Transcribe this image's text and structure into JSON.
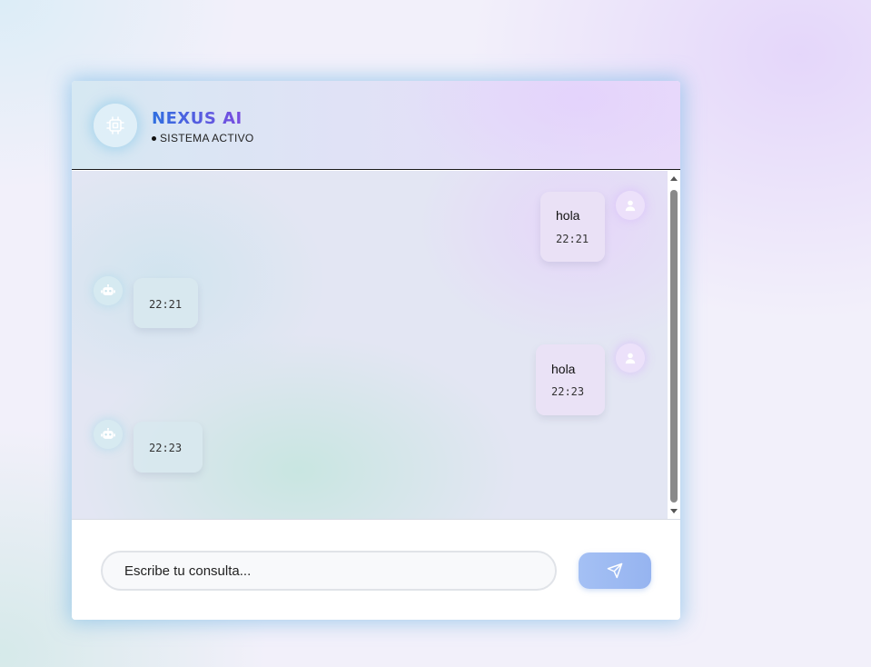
{
  "header": {
    "title": "NEXUS AI",
    "status": "SISTEMA ACTIVO",
    "avatar_icon": "cpu-chip-icon"
  },
  "messages": [
    {
      "sender": "user",
      "text": "hola",
      "time": "22:21",
      "avatar_icon": "user-icon"
    },
    {
      "sender": "bot",
      "text": "",
      "time": "22:21",
      "avatar_icon": "robot-icon"
    },
    {
      "sender": "user",
      "text": "hola",
      "time": "22:23",
      "avatar_icon": "user-icon"
    },
    {
      "sender": "bot",
      "text": "",
      "time": "22:23",
      "avatar_icon": "robot-icon"
    }
  ],
  "composer": {
    "placeholder": "Escribe tu consulta...",
    "send_icon": "send-icon"
  },
  "colors": {
    "title_gradient_start": "#2f6fe0",
    "title_gradient_end": "#7a4ce0",
    "send_button": "#9ab8f2"
  }
}
